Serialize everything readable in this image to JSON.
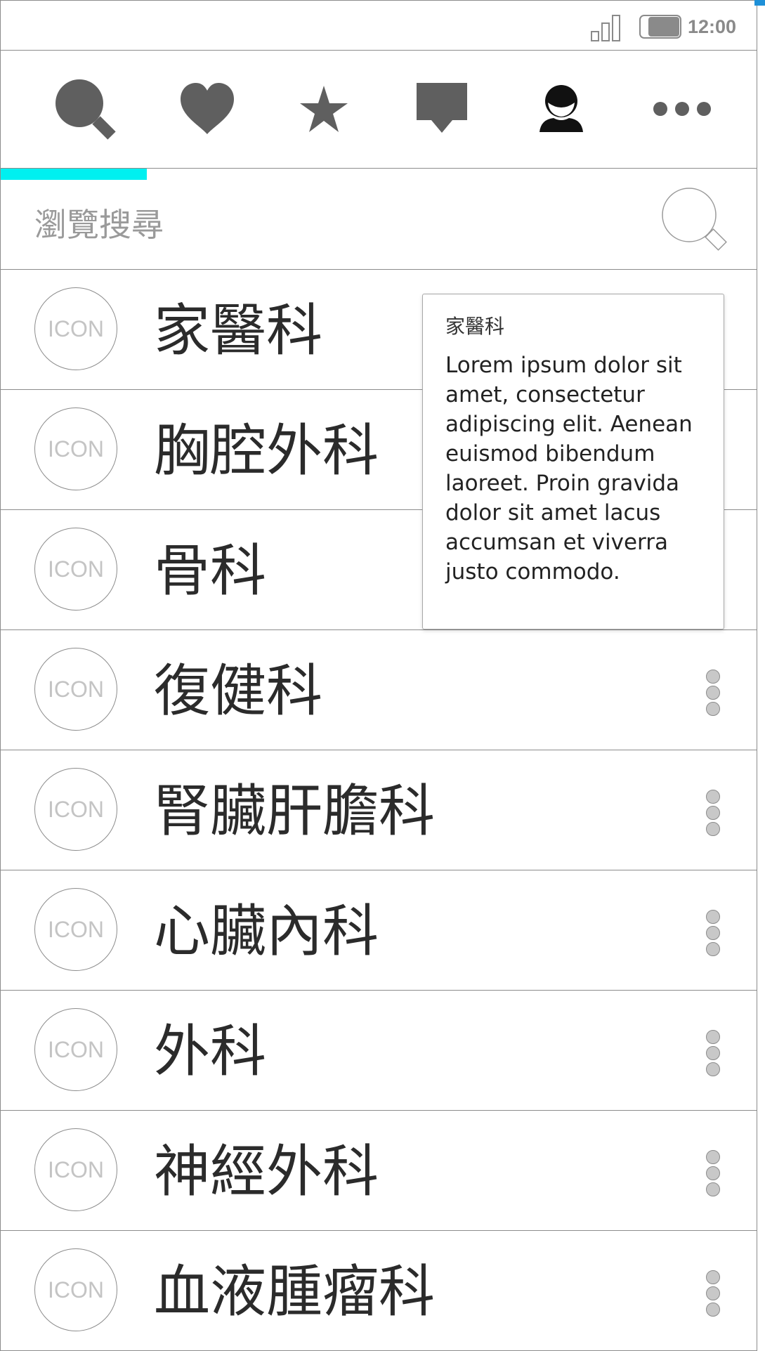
{
  "status_bar": {
    "time": "12:00",
    "icons": [
      "signal-icon",
      "battery-icon"
    ]
  },
  "tabs": [
    {
      "name": "search",
      "icon": "search-icon"
    },
    {
      "name": "favorites",
      "icon": "heart-icon"
    },
    {
      "name": "starred",
      "icon": "star-icon"
    },
    {
      "name": "messages",
      "icon": "chat-icon"
    },
    {
      "name": "profile",
      "icon": "person-icon"
    },
    {
      "name": "more",
      "icon": "more-icon"
    }
  ],
  "active_tab_index": 0,
  "colors": {
    "icon_gray": "#5f5f5f",
    "active_indicator": "#00f0f0",
    "border": "#8c8c8c",
    "placeholder": "#9a9a9a"
  },
  "search": {
    "placeholder": "瀏覽搜尋",
    "value": ""
  },
  "list": {
    "icon_placeholder": "ICON",
    "items": [
      {
        "label": "家醫科"
      },
      {
        "label": "胸腔外科"
      },
      {
        "label": "骨科"
      },
      {
        "label": "復健科"
      },
      {
        "label": "腎臟肝膽科"
      },
      {
        "label": "心臟內科"
      },
      {
        "label": "外科"
      },
      {
        "label": "神經外科"
      },
      {
        "label": "血液腫瘤科"
      }
    ]
  },
  "popover": {
    "title": "家醫科",
    "body": "Lorem ipsum dolor sit amet, consectetur adipiscing elit. Aenean euismod bibendum laoreet. Proin gravida dolor sit amet lacus accumsan et viverra justo commodo."
  }
}
